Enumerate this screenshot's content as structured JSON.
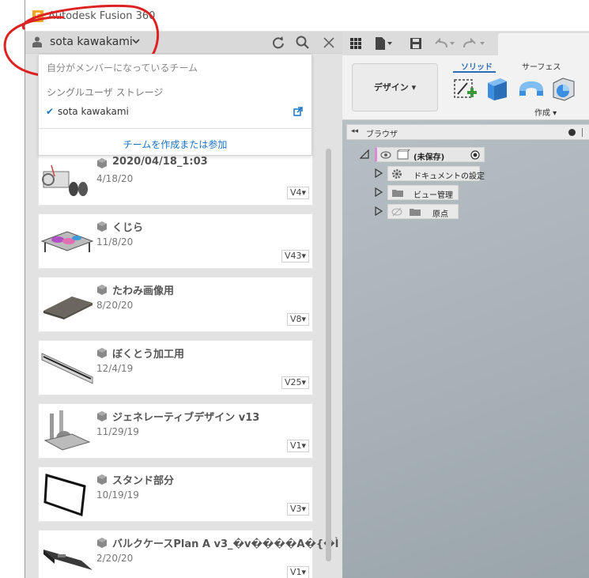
{
  "window": {
    "title": "Autodesk Fusion 360",
    "app_icon_letter": "F"
  },
  "data_panel": {
    "user_name": "sota kawakami",
    "dropdown": {
      "faded_text": "自分がメンバーになっているチーム",
      "section_label": "シングルユーザ ストレージ",
      "current_user": "sota kawakami",
      "join_team_label": "チームを作成または参加"
    },
    "designs": [
      {
        "name": "2020/04/18_1:03",
        "date": "4/18/20",
        "version": "V4▾"
      },
      {
        "name": "くじら",
        "date": "11/8/20",
        "version": "V43▾"
      },
      {
        "name": "たわみ画像用",
        "date": "8/20/20",
        "version": "V8▾"
      },
      {
        "name": "ぼくとう加工用",
        "date": "12/4/19",
        "version": "V25▾"
      },
      {
        "name": "ジェネレーティブデザイン v13",
        "date": "11/29/19",
        "version": "V1▾"
      },
      {
        "name": "スタンド部分",
        "date": "10/19/19",
        "version": "V3▾"
      },
      {
        "name": "バルクケースPlan A v3_�v����A�{�Ì",
        "date": "2/20/20",
        "version": "V1▾"
      }
    ]
  },
  "toolbar": {
    "workspace_label": "デザイン ▾",
    "tab_solid": "ソリッド",
    "tab_surface": "サーフェス",
    "create_label": "作成 ▾"
  },
  "browser": {
    "collapse_glyph": "◂◂",
    "title": "ブラウザ",
    "root_label": "(未保存)",
    "items": [
      {
        "label": "ドキュメントの設定",
        "icon": "gear-icon"
      },
      {
        "label": "ビュー管理",
        "icon": "folder-icon"
      },
      {
        "label": "原点",
        "icon": "folder-icon"
      }
    ]
  },
  "colors": {
    "accent": "#2b6cb5",
    "link": "#1a73c6",
    "app_icon": "#f5a623"
  }
}
